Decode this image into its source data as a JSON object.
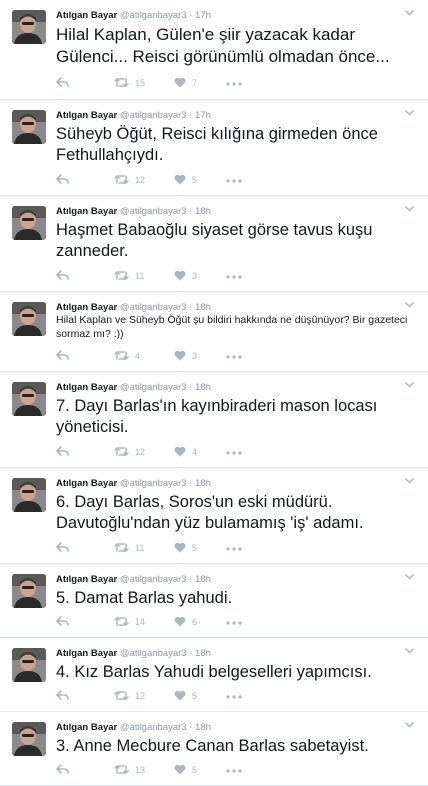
{
  "colors": {
    "name": "#14171a",
    "meta": "#8899a6",
    "icon": "#aab8c2",
    "divider": "#e1e8ed"
  },
  "icons": {
    "avatar": "profile-photo",
    "menu": "chevron-down-icon",
    "reply": "reply-icon",
    "retweet": "retweet-icon",
    "like": "heart-icon",
    "more": "more-icon"
  },
  "tweets": [
    {
      "name": "Atılgan Bayar",
      "handle": "@atilganbayar3",
      "time": "17h",
      "text": "Hilal Kaplan, Gülen'e şiir yazacak kadar Gülenci... Reisci görünümlü olmadan önce...",
      "retweets": "15",
      "likes": "7"
    },
    {
      "name": "Atılgan Bayar",
      "handle": "@atilganbayar3",
      "time": "17h",
      "text": "Süheyb Öğüt, Reisci kılığına girmeden önce Fethullahçıydı.",
      "retweets": "12",
      "likes": "5"
    },
    {
      "name": "Atılgan Bayar",
      "handle": "@atilganbayar3",
      "time": "18h",
      "text": "Haşmet Babaoğlu siyaset görse tavus kuşu zanneder.",
      "retweets": "11",
      "likes": "3"
    },
    {
      "name": "Atılgan Bayar",
      "handle": "@atilganbayar3",
      "time": "18h",
      "text": "Hilal Kaplan ve Süheyb Öğüt şu bildiri hakkında ne düşünüyor? Bir gazeteci sormaz mı? :))",
      "retweets": "4",
      "likes": "3"
    },
    {
      "name": "Atılgan Bayar",
      "handle": "@atilganbayar3",
      "time": "18h",
      "text": "7. Dayı Barlas'ın kayınbiraderi mason locası yöneticisi.",
      "retweets": "12",
      "likes": "4"
    },
    {
      "name": "Atılgan Bayar",
      "handle": "@atilganbayar3",
      "time": "18h",
      "text": "6. Dayı Barlas, Soros'un eski müdürü. Davutoğlu'ndan yüz bulamamış 'iş' adamı.",
      "retweets": "11",
      "likes": "5"
    },
    {
      "name": "Atılgan Bayar",
      "handle": "@atilganbayar3",
      "time": "18h",
      "text": "5. Damat Barlas yahudi.",
      "retweets": "14",
      "likes": "6"
    },
    {
      "name": "Atılgan Bayar",
      "handle": "@atilganbayar3",
      "time": "18h",
      "text": "4. Kız Barlas Yahudi belgeselleri yapımcısı.",
      "retweets": "12",
      "likes": "5"
    },
    {
      "name": "Atılgan Bayar",
      "handle": "@atilganbayar3",
      "time": "18h",
      "text": "3. Anne Mecbure Canan Barlas sabetayist.",
      "retweets": "13",
      "likes": "5"
    }
  ]
}
